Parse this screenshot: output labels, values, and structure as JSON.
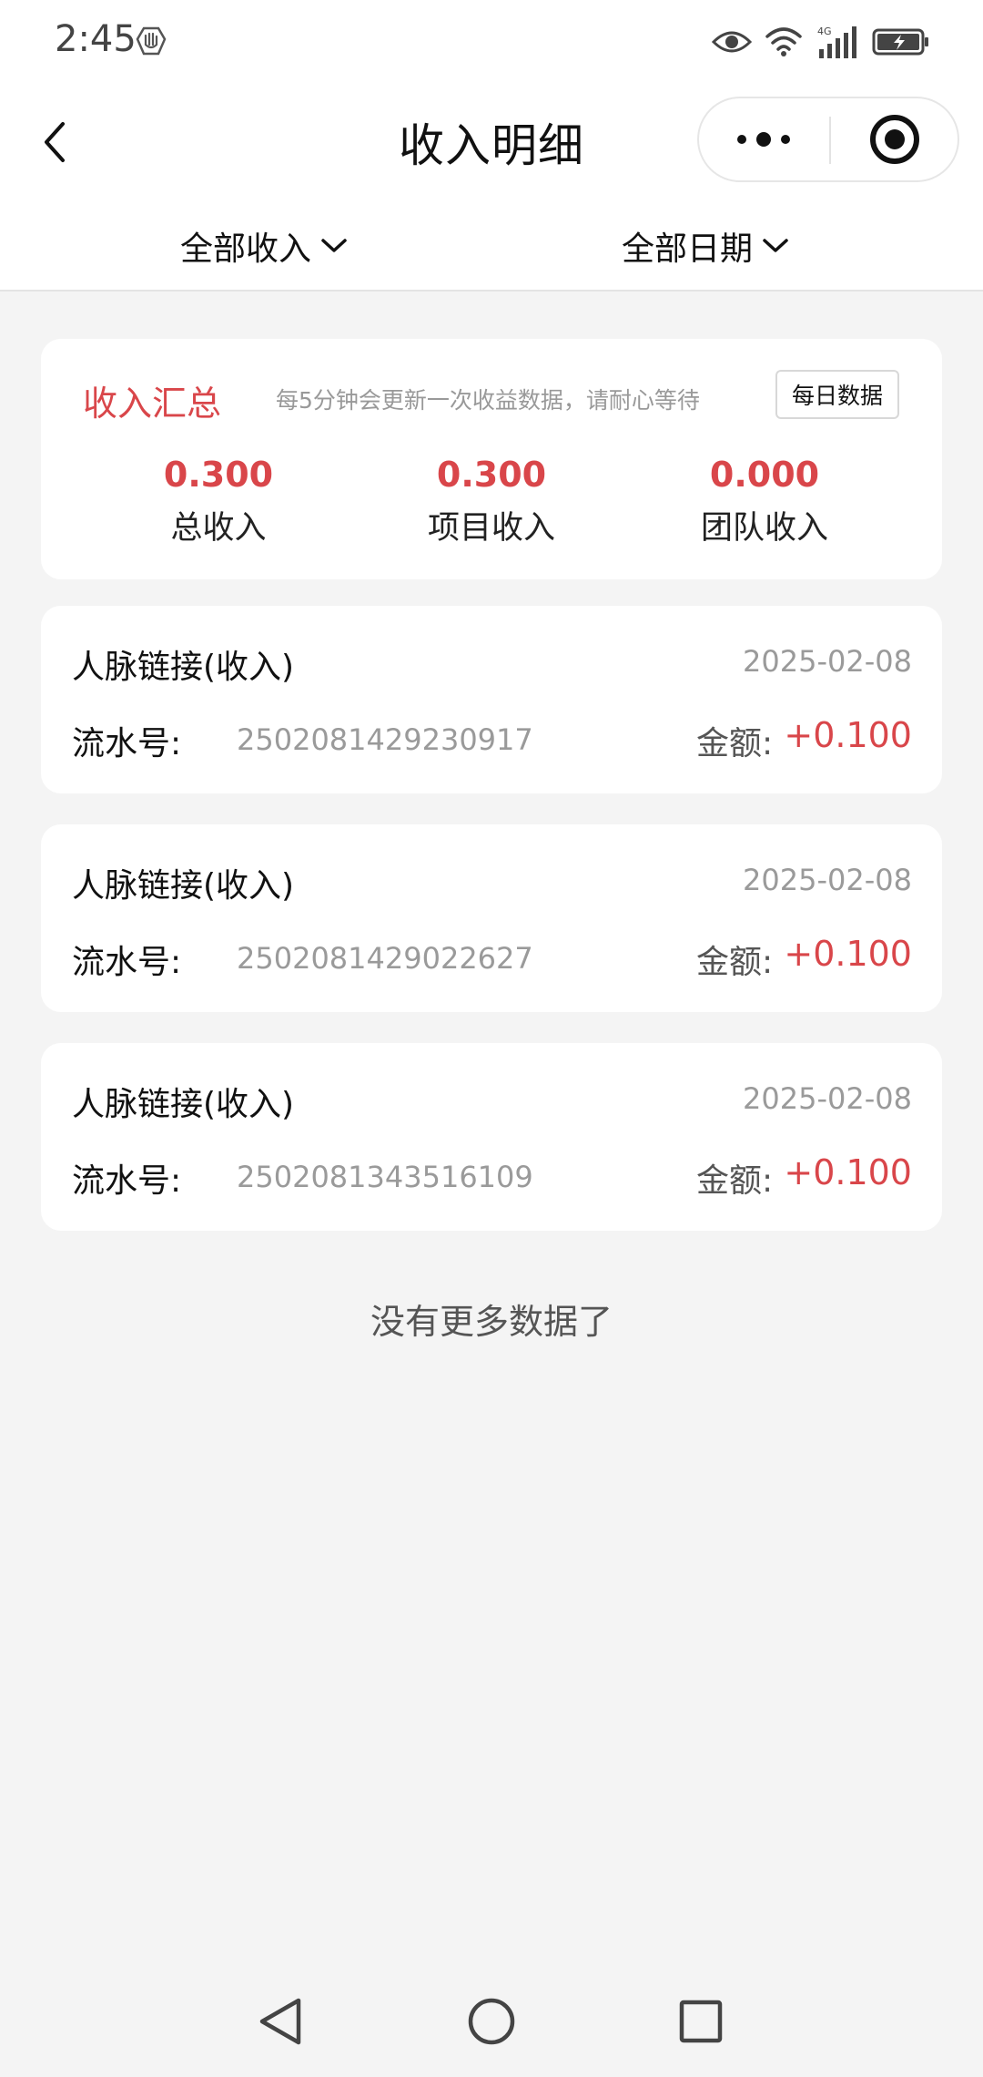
{
  "status_bar": {
    "time": "2:45",
    "network_label": "4G"
  },
  "nav": {
    "title": "收入明细"
  },
  "filters": {
    "income_type": "全部收入",
    "date_range": "全部日期"
  },
  "summary": {
    "title": "收入汇总",
    "hint": "每5分钟会更新一次收益数据，请耐心等待",
    "daily_button": "每日数据",
    "stats": [
      {
        "value": "0.300",
        "label": "总收入"
      },
      {
        "value": "0.300",
        "label": "项目收入"
      },
      {
        "value": "0.000",
        "label": "团队收入"
      }
    ]
  },
  "records": [
    {
      "title": "人脉链接(收入)",
      "date": "2025-02-08",
      "serial_label": "流水号:",
      "serial": "2502081429230917",
      "amount_label": "金额:",
      "amount": "+0.100"
    },
    {
      "title": "人脉链接(收入)",
      "date": "2025-02-08",
      "serial_label": "流水号:",
      "serial": "2502081429022627",
      "amount_label": "金额:",
      "amount": "+0.100"
    },
    {
      "title": "人脉链接(收入)",
      "date": "2025-02-08",
      "serial_label": "流水号:",
      "serial": "2502081343516109",
      "amount_label": "金额:",
      "amount": "+0.100"
    }
  ],
  "end_text": "没有更多数据了",
  "colors": {
    "accent": "#d9464a",
    "background": "#f4f4f4",
    "muted_text": "#9a9a9a"
  },
  "icons": [
    "hand-icon",
    "eye-icon",
    "wifi-icon",
    "signal-icon",
    "battery-icon",
    "back-arrow-icon",
    "more-icon",
    "target-icon",
    "chevron-down-icon",
    "triangle-back-icon",
    "circle-home-icon",
    "square-recent-icon"
  ]
}
